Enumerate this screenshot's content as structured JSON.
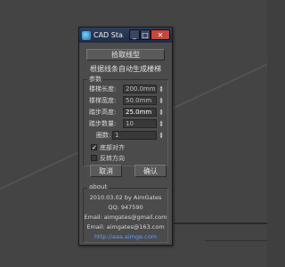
{
  "window": {
    "title": "CAD Sta...",
    "minimize": "_",
    "maximize": "□",
    "close": "✕"
  },
  "top": {
    "pick_button": "拾取线型",
    "subtitle": "根据线条自动生成楼梯"
  },
  "params": {
    "group_title": "参数",
    "fields": [
      {
        "label": "楼梯长度:",
        "value": "200.0mm"
      },
      {
        "label": "楼梯宽度:",
        "value": "50.0mm"
      },
      {
        "label": "踏步高度:",
        "value": "25.0mm"
      },
      {
        "label": "踏步数量:",
        "value": "10"
      }
    ],
    "turns_label": "圈数:",
    "turns_value": "1",
    "checks": [
      {
        "label": "底部对齐",
        "checked": true,
        "mark": "✓"
      },
      {
        "label": "反转方向",
        "checked": false,
        "mark": ""
      }
    ]
  },
  "actions": {
    "cancel": "取消",
    "ok": "确认"
  },
  "about": {
    "title": "about",
    "date_author": "2010.03.02   by    AimGates",
    "qq": "QQ:  947590",
    "email1": "Email:  aimgates@gmail.com",
    "email2": "Email:  aimgates@163.com",
    "link": "http://aaa.aimge.com"
  }
}
